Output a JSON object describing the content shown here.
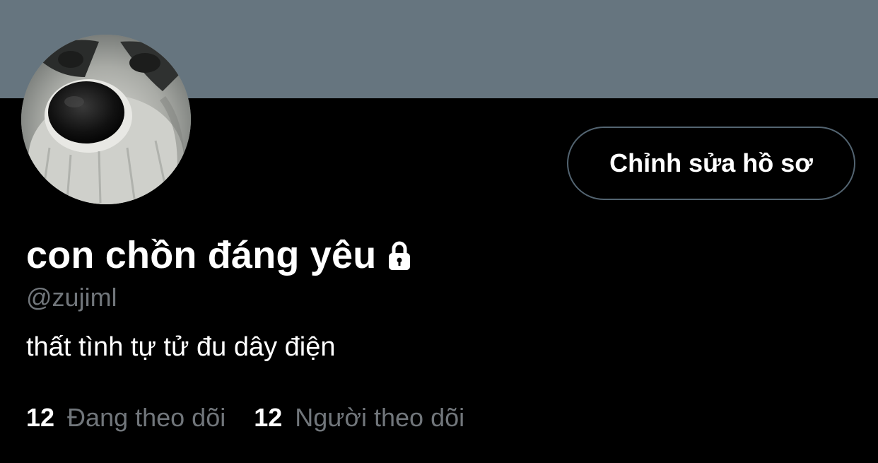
{
  "profile": {
    "banner_color": "#66757f",
    "avatar_alt": "raccoon close-up avatar",
    "display_name": "con chồn đáng yêu",
    "protected_icon": "lock-icon",
    "handle": "@zujiml",
    "bio": "thất tình tự tử đu dây điện"
  },
  "actions": {
    "edit_profile_label": "Chỉnh sửa hồ sơ"
  },
  "stats": {
    "following_count": "12",
    "following_label": "Đang theo dõi",
    "followers_count": "12",
    "followers_label": "Người theo dõi"
  },
  "colors": {
    "background": "#000000",
    "secondary_text": "#71767b",
    "button_border": "#536471"
  }
}
